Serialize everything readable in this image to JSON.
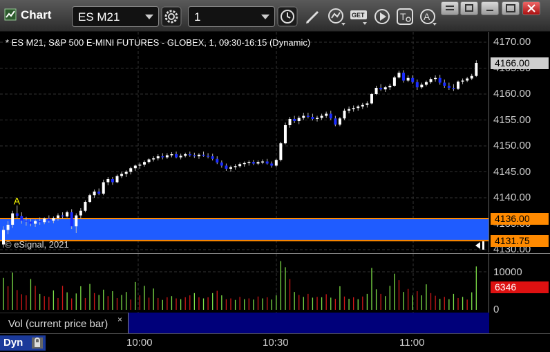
{
  "window": {
    "title": "Chart",
    "symbol": "ES M21",
    "interval": "1"
  },
  "chart": {
    "header": "* ES M21, S&P 500 E-MINI FUTURES - GLOBEX, 1, 09:30-16:15 (Dynamic)",
    "copyright": "© eSignal, 2021",
    "price_labels": [
      "4170.00",
      "4165.00",
      "4160.00",
      "4155.00",
      "4150.00",
      "4145.00",
      "4140.00",
      "4135.00",
      "4130.00"
    ],
    "last_price": "4166.00",
    "zone_top": "4136.00",
    "zone_bottom": "4131.75",
    "marker": "A",
    "colors": {
      "up": "#ffffff",
      "down": "#1a2cff",
      "zone": "#1f5cff",
      "zone_line": "#ff8a00"
    },
    "candles": [
      [
        4131.0,
        4134.5,
        4130.4,
        4133.8
      ],
      [
        4133.8,
        4135.5,
        4133.0,
        4134.8
      ],
      [
        4134.8,
        4137.5,
        4134.2,
        4137.0
      ],
      [
        4137.0,
        4138.5,
        4136.0,
        4136.5
      ],
      [
        4136.5,
        4137.2,
        4135.0,
        4135.6
      ],
      [
        4135.6,
        4136.3,
        4134.6,
        4135.4
      ],
      [
        4135.4,
        4135.9,
        4134.5,
        4135.0
      ],
      [
        4135.0,
        4135.8,
        4134.4,
        4135.5
      ],
      [
        4135.5,
        4136.2,
        4134.8,
        4135.3
      ],
      [
        4135.3,
        4136.2,
        4134.9,
        4136.0
      ],
      [
        4136.0,
        4136.6,
        4135.2,
        4135.6
      ],
      [
        4135.6,
        4136.4,
        4135.1,
        4136.1
      ],
      [
        4136.1,
        4137.0,
        4135.6,
        4136.6
      ],
      [
        4136.6,
        4137.2,
        4136.0,
        4136.4
      ],
      [
        4136.4,
        4137.5,
        4136.2,
        4137.2
      ],
      [
        4137.2,
        4137.8,
        4134.0,
        4134.5
      ],
      [
        4134.5,
        4137.0,
        4133.2,
        4136.6
      ],
      [
        4136.6,
        4138.0,
        4136.0,
        4137.5
      ],
      [
        4137.5,
        4139.5,
        4137.2,
        4139.2
      ],
      [
        4139.2,
        4140.8,
        4139.0,
        4140.5
      ],
      [
        4140.5,
        4141.6,
        4140.0,
        4141.2
      ],
      [
        4141.2,
        4141.8,
        4140.5,
        4140.8
      ],
      [
        4140.8,
        4143.5,
        4140.5,
        4143.0
      ],
      [
        4143.0,
        4144.0,
        4142.4,
        4143.6
      ],
      [
        4143.6,
        4144.0,
        4142.5,
        4143.0
      ],
      [
        4143.0,
        4144.5,
        4142.8,
        4144.2
      ],
      [
        4144.2,
        4145.0,
        4143.8,
        4144.6
      ],
      [
        4144.6,
        4145.3,
        4144.0,
        4145.0
      ],
      [
        4145.0,
        4146.0,
        4144.5,
        4145.7
      ],
      [
        4145.7,
        4146.4,
        4145.2,
        4146.2
      ],
      [
        4146.2,
        4146.8,
        4145.6,
        4146.4
      ],
      [
        4146.4,
        4147.2,
        4146.0,
        4146.9
      ],
      [
        4146.9,
        4147.6,
        4146.6,
        4147.4
      ],
      [
        4147.4,
        4148.0,
        4147.0,
        4147.6
      ],
      [
        4147.6,
        4148.4,
        4147.2,
        4148.0
      ],
      [
        4148.0,
        4148.6,
        4147.4,
        4147.8
      ],
      [
        4147.8,
        4148.6,
        4147.5,
        4148.2
      ],
      [
        4148.2,
        4148.8,
        4147.8,
        4148.4
      ],
      [
        4148.4,
        4148.9,
        4147.6,
        4147.8
      ],
      [
        4147.8,
        4148.5,
        4147.4,
        4148.1
      ],
      [
        4148.1,
        4148.7,
        4147.8,
        4148.4
      ],
      [
        4148.4,
        4148.9,
        4147.9,
        4148.2
      ],
      [
        4148.2,
        4148.7,
        4147.7,
        4148.0
      ],
      [
        4148.0,
        4148.6,
        4147.5,
        4148.3
      ],
      [
        4148.3,
        4148.9,
        4147.9,
        4148.1
      ],
      [
        4148.1,
        4148.6,
        4147.6,
        4148.0
      ],
      [
        4148.0,
        4148.5,
        4147.2,
        4147.5
      ],
      [
        4147.5,
        4148.0,
        4146.5,
        4146.8
      ],
      [
        4146.8,
        4147.2,
        4145.8,
        4146.2
      ],
      [
        4146.2,
        4146.6,
        4145.2,
        4145.6
      ],
      [
        4145.6,
        4146.2,
        4145.0,
        4145.9
      ],
      [
        4145.9,
        4146.5,
        4145.4,
        4146.1
      ],
      [
        4146.1,
        4146.8,
        4145.8,
        4146.5
      ],
      [
        4146.5,
        4147.0,
        4146.0,
        4146.7
      ],
      [
        4146.7,
        4147.2,
        4146.2,
        4146.9
      ],
      [
        4146.9,
        4147.3,
        4146.3,
        4146.6
      ],
      [
        4146.6,
        4147.2,
        4146.3,
        4146.9
      ],
      [
        4146.9,
        4147.4,
        4146.5,
        4147.0
      ],
      [
        4147.0,
        4147.5,
        4146.4,
        4146.6
      ],
      [
        4146.6,
        4147.0,
        4145.8,
        4146.2
      ],
      [
        4146.2,
        4147.5,
        4145.9,
        4147.3
      ],
      [
        4147.3,
        4150.8,
        4147.0,
        4150.5
      ],
      [
        4150.5,
        4154.5,
        4150.3,
        4154.0
      ],
      [
        4154.0,
        4155.6,
        4153.5,
        4155.2
      ],
      [
        4155.2,
        4155.8,
        4154.4,
        4154.8
      ],
      [
        4154.8,
        4155.8,
        4154.2,
        4155.4
      ],
      [
        4155.4,
        4156.4,
        4155.0,
        4155.8
      ],
      [
        4155.8,
        4156.4,
        4155.3,
        4155.6
      ],
      [
        4155.6,
        4156.2,
        4154.9,
        4155.2
      ],
      [
        4155.2,
        4155.8,
        4154.7,
        4155.4
      ],
      [
        4155.4,
        4156.2,
        4155.0,
        4155.8
      ],
      [
        4155.8,
        4156.6,
        4155.4,
        4156.2
      ],
      [
        4156.2,
        4156.8,
        4155.0,
        4155.3
      ],
      [
        4155.3,
        4155.8,
        4153.8,
        4154.1
      ],
      [
        4154.1,
        4155.6,
        4153.8,
        4155.3
      ],
      [
        4155.3,
        4157.2,
        4155.0,
        4156.8
      ],
      [
        4156.8,
        4157.6,
        4156.3,
        4157.1
      ],
      [
        4157.1,
        4157.8,
        4156.6,
        4157.3
      ],
      [
        4157.3,
        4157.9,
        4156.8,
        4157.6
      ],
      [
        4157.6,
        4158.3,
        4157.1,
        4157.9
      ],
      [
        4157.9,
        4158.6,
        4157.4,
        4158.2
      ],
      [
        4158.2,
        4160.2,
        4158.0,
        4160.0
      ],
      [
        4160.0,
        4161.6,
        4159.8,
        4161.2
      ],
      [
        4161.2,
        4161.9,
        4160.6,
        4160.9
      ],
      [
        4160.9,
        4161.6,
        4160.4,
        4161.3
      ],
      [
        4161.3,
        4162.0,
        4160.8,
        4161.6
      ],
      [
        4161.6,
        4163.5,
        4161.4,
        4163.2
      ],
      [
        4163.2,
        4164.5,
        4163.0,
        4164.1
      ],
      [
        4164.1,
        4164.6,
        4162.2,
        4162.6
      ],
      [
        4162.6,
        4163.6,
        4162.3,
        4163.1
      ],
      [
        4163.1,
        4163.6,
        4162.0,
        4162.3
      ],
      [
        4162.3,
        4162.8,
        4160.8,
        4161.3
      ],
      [
        4161.3,
        4162.2,
        4161.0,
        4161.8
      ],
      [
        4161.8,
        4162.6,
        4161.5,
        4162.3
      ],
      [
        4162.3,
        4163.2,
        4162.0,
        4162.9
      ],
      [
        4162.9,
        4163.6,
        4162.4,
        4163.1
      ],
      [
        4163.1,
        4163.7,
        4161.8,
        4162.2
      ],
      [
        4162.2,
        4162.8,
        4161.2,
        4161.6
      ],
      [
        4161.6,
        4162.2,
        4160.8,
        4161.2
      ],
      [
        4161.2,
        4161.9,
        4160.6,
        4161.0
      ],
      [
        4161.0,
        4162.6,
        4160.8,
        4162.4
      ],
      [
        4162.4,
        4163.0,
        4161.9,
        4162.6
      ],
      [
        4162.6,
        4163.3,
        4162.3,
        4163.0
      ],
      [
        4163.0,
        4163.9,
        4162.7,
        4163.5
      ],
      [
        4163.5,
        4166.5,
        4163.3,
        4166.0
      ]
    ],
    "volumes": [
      [
        8400,
        true
      ],
      [
        6200,
        false
      ],
      [
        9800,
        true
      ],
      [
        5200,
        false
      ],
      [
        4100,
        false
      ],
      [
        3800,
        false
      ],
      [
        8100,
        true
      ],
      [
        6300,
        false
      ],
      [
        4200,
        true
      ],
      [
        3600,
        false
      ],
      [
        3400,
        false
      ],
      [
        5100,
        true
      ],
      [
        3100,
        false
      ],
      [
        6300,
        false
      ],
      [
        4600,
        true
      ],
      [
        3000,
        false
      ],
      [
        4300,
        true
      ],
      [
        6200,
        true
      ],
      [
        3100,
        false
      ],
      [
        6800,
        true
      ],
      [
        4400,
        false
      ],
      [
        3900,
        true
      ],
      [
        5300,
        true
      ],
      [
        3600,
        false
      ],
      [
        4900,
        true
      ],
      [
        3100,
        false
      ],
      [
        3900,
        true
      ],
      [
        4700,
        true
      ],
      [
        2700,
        false
      ],
      [
        7300,
        true
      ],
      [
        3800,
        false
      ],
      [
        6300,
        true
      ],
      [
        3200,
        false
      ],
      [
        5600,
        true
      ],
      [
        3100,
        false
      ],
      [
        2600,
        true
      ],
      [
        3300,
        false
      ],
      [
        3600,
        true
      ],
      [
        3000,
        false
      ],
      [
        2800,
        true
      ],
      [
        3300,
        false
      ],
      [
        3800,
        false
      ],
      [
        4400,
        true
      ],
      [
        3300,
        false
      ],
      [
        3000,
        true
      ],
      [
        3300,
        false
      ],
      [
        4400,
        true
      ],
      [
        5000,
        false
      ],
      [
        3800,
        true
      ],
      [
        2800,
        false
      ],
      [
        3000,
        false
      ],
      [
        2600,
        true
      ],
      [
        3400,
        false
      ],
      [
        2800,
        true
      ],
      [
        3000,
        false
      ],
      [
        2700,
        true
      ],
      [
        3500,
        false
      ],
      [
        3000,
        true
      ],
      [
        3300,
        false
      ],
      [
        2700,
        true
      ],
      [
        3800,
        true
      ],
      [
        12800,
        true
      ],
      [
        11200,
        true
      ],
      [
        8100,
        false
      ],
      [
        4700,
        true
      ],
      [
        3900,
        false
      ],
      [
        3400,
        true
      ],
      [
        4200,
        false
      ],
      [
        3200,
        true
      ],
      [
        3400,
        false
      ],
      [
        3300,
        true
      ],
      [
        4100,
        false
      ],
      [
        3200,
        true
      ],
      [
        2900,
        false
      ],
      [
        6200,
        true
      ],
      [
        3500,
        false
      ],
      [
        2900,
        true
      ],
      [
        3300,
        false
      ],
      [
        2800,
        true
      ],
      [
        3500,
        false
      ],
      [
        4200,
        true
      ],
      [
        11000,
        true
      ],
      [
        5400,
        true
      ],
      [
        4200,
        false
      ],
      [
        3600,
        true
      ],
      [
        6300,
        true
      ],
      [
        9500,
        true
      ],
      [
        7800,
        false
      ],
      [
        4700,
        true
      ],
      [
        5500,
        false
      ],
      [
        3800,
        true
      ],
      [
        4900,
        false
      ],
      [
        3800,
        true
      ],
      [
        6700,
        true
      ],
      [
        4400,
        false
      ],
      [
        3700,
        false
      ],
      [
        2900,
        true
      ],
      [
        3400,
        false
      ],
      [
        2800,
        true
      ],
      [
        4200,
        true
      ],
      [
        3100,
        false
      ],
      [
        3400,
        true
      ],
      [
        2700,
        false
      ],
      [
        4600,
        true
      ],
      [
        11400,
        true
      ]
    ]
  },
  "volume_pane": {
    "title": "Vol (current price bar)",
    "close": "×",
    "axis_labels": [
      "10000",
      "0"
    ],
    "current": "6346"
  },
  "time_axis": {
    "labels": [
      "10:00",
      "10:30",
      "11:00"
    ],
    "mode": "Dyn"
  }
}
